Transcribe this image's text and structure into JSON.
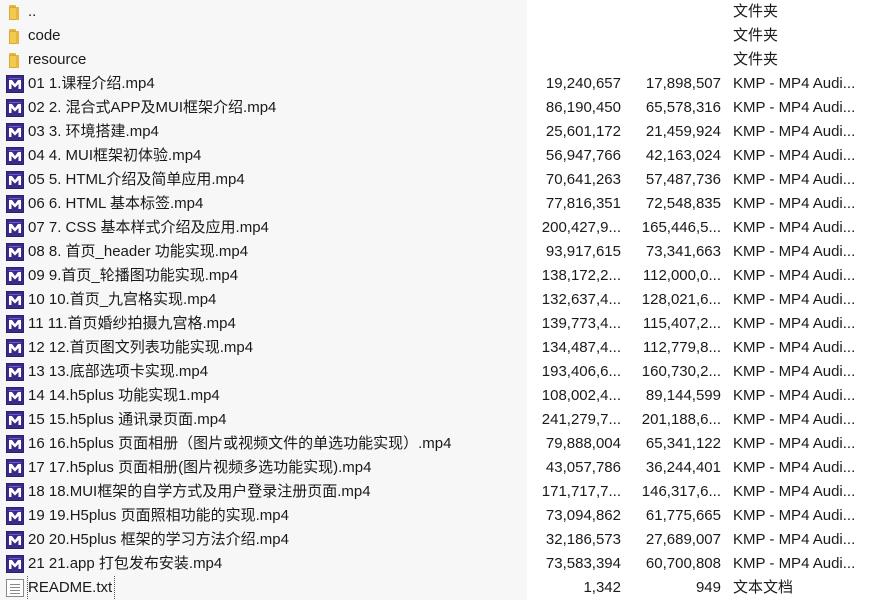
{
  "files": [
    {
      "name": "..",
      "size": "",
      "compressed": "",
      "type": "文件夹",
      "icon": "folder-icon"
    },
    {
      "name": "code",
      "size": "",
      "compressed": "",
      "type": "文件夹",
      "icon": "folder-icon"
    },
    {
      "name": "resource",
      "size": "",
      "compressed": "",
      "type": "文件夹",
      "icon": "folder-icon"
    },
    {
      "name": "01 1.课程介绍.mp4",
      "size": "19,240,657",
      "compressed": "17,898,507",
      "type": "KMP - MP4 Audi...",
      "icon": "mp4-icon"
    },
    {
      "name": "02 2. 混合式APP及MUI框架介绍.mp4",
      "size": "86,190,450",
      "compressed": "65,578,316",
      "type": "KMP - MP4 Audi...",
      "icon": "mp4-icon"
    },
    {
      "name": "03 3. 环境搭建.mp4",
      "size": "25,601,172",
      "compressed": "21,459,924",
      "type": "KMP - MP4 Audi...",
      "icon": "mp4-icon"
    },
    {
      "name": "04 4. MUI框架初体验.mp4",
      "size": "56,947,766",
      "compressed": "42,163,024",
      "type": "KMP - MP4 Audi...",
      "icon": "mp4-icon"
    },
    {
      "name": "05 5. HTML介绍及简单应用.mp4",
      "size": "70,641,263",
      "compressed": "57,487,736",
      "type": "KMP - MP4 Audi...",
      "icon": "mp4-icon"
    },
    {
      "name": "06 6. HTML 基本标签.mp4",
      "size": "77,816,351",
      "compressed": "72,548,835",
      "type": "KMP - MP4 Audi...",
      "icon": "mp4-icon"
    },
    {
      "name": "07 7. CSS 基本样式介绍及应用.mp4",
      "size": "200,427,9...",
      "compressed": "165,446,5...",
      "type": "KMP - MP4 Audi...",
      "icon": "mp4-icon"
    },
    {
      "name": "08 8. 首页_header 功能实现.mp4",
      "size": "93,917,615",
      "compressed": "73,341,663",
      "type": "KMP - MP4 Audi...",
      "icon": "mp4-icon"
    },
    {
      "name": "09 9.首页_轮播图功能实现.mp4",
      "size": "138,172,2...",
      "compressed": "112,000,0...",
      "type": "KMP - MP4 Audi...",
      "icon": "mp4-icon"
    },
    {
      "name": "10 10.首页_九宫格实现.mp4",
      "size": "132,637,4...",
      "compressed": "128,021,6...",
      "type": "KMP - MP4 Audi...",
      "icon": "mp4-icon"
    },
    {
      "name": "11 11.首页婚纱拍摄九宫格.mp4",
      "size": "139,773,4...",
      "compressed": "115,407,2...",
      "type": "KMP - MP4 Audi...",
      "icon": "mp4-icon"
    },
    {
      "name": "12 12.首页图文列表功能实现.mp4",
      "size": "134,487,4...",
      "compressed": "112,779,8...",
      "type": "KMP - MP4 Audi...",
      "icon": "mp4-icon"
    },
    {
      "name": "13 13.底部选项卡实现.mp4",
      "size": "193,406,6...",
      "compressed": "160,730,2...",
      "type": "KMP - MP4 Audi...",
      "icon": "mp4-icon"
    },
    {
      "name": "14 14.h5plus 功能实现1.mp4",
      "size": "108,002,4...",
      "compressed": "89,144,599",
      "type": "KMP - MP4 Audi...",
      "icon": "mp4-icon"
    },
    {
      "name": "15 15.h5plus 通讯录页面.mp4",
      "size": "241,279,7...",
      "compressed": "201,188,6...",
      "type": "KMP - MP4 Audi...",
      "icon": "mp4-icon"
    },
    {
      "name": "16 16.h5plus 页面相册（图片或视频文件的单选功能实现）.mp4",
      "size": "79,888,004",
      "compressed": "65,341,122",
      "type": "KMP - MP4 Audi...",
      "icon": "mp4-icon"
    },
    {
      "name": "17 17.h5plus 页面相册(图片视频多选功能实现).mp4",
      "size": "43,057,786",
      "compressed": "36,244,401",
      "type": "KMP - MP4 Audi...",
      "icon": "mp4-icon"
    },
    {
      "name": "18 18.MUI框架的自学方式及用户登录注册页面.mp4",
      "size": "171,717,7...",
      "compressed": "146,317,6...",
      "type": "KMP - MP4 Audi...",
      "icon": "mp4-icon"
    },
    {
      "name": "19 19.H5plus 页面照相功能的实现.mp4",
      "size": "73,094,862",
      "compressed": "61,775,665",
      "type": "KMP - MP4 Audi...",
      "icon": "mp4-icon"
    },
    {
      "name": "20 20.H5plus 框架的学习方法介绍.mp4",
      "size": "32,186,573",
      "compressed": "27,689,007",
      "type": "KMP - MP4 Audi...",
      "icon": "mp4-icon"
    },
    {
      "name": "21 21.app 打包发布安装.mp4",
      "size": "73,583,394",
      "compressed": "60,700,808",
      "type": "KMP - MP4 Audi...",
      "icon": "mp4-icon"
    },
    {
      "name": "README.txt",
      "size": "1,342",
      "compressed": "949",
      "type": "文本文档",
      "icon": "txt-icon"
    }
  ]
}
